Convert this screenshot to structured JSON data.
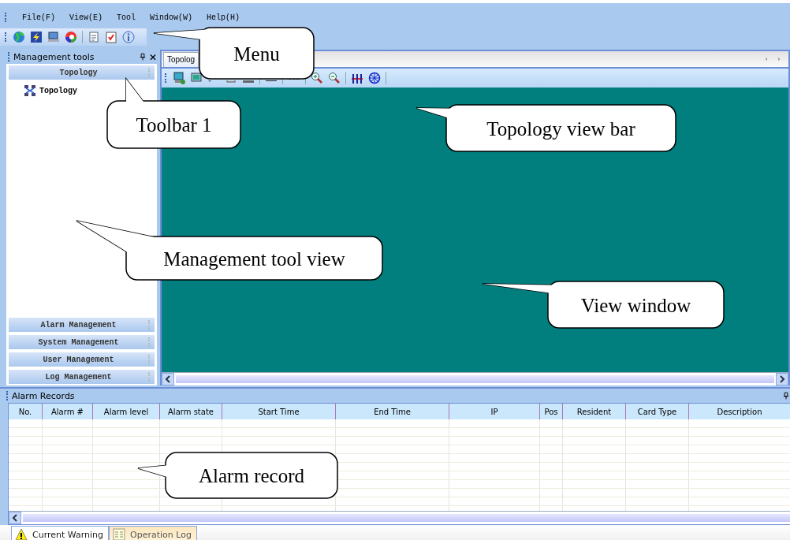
{
  "menu": [
    {
      "label": "File(F)"
    },
    {
      "label": "View(E)"
    },
    {
      "label": "Tool"
    },
    {
      "label": "Window(W)"
    },
    {
      "label": "Help(H)"
    }
  ],
  "management_tools": {
    "title": "Management tools",
    "sections": [
      {
        "label": "Topology",
        "expanded": true,
        "items": [
          {
            "label": "Topology"
          }
        ]
      },
      {
        "label": "Alarm Management",
        "expanded": false
      },
      {
        "label": "System Management",
        "expanded": false
      },
      {
        "label": "User Management",
        "expanded": false
      },
      {
        "label": "Log Management",
        "expanded": false
      }
    ]
  },
  "view_tabs": [
    {
      "label": "Topolog",
      "selected": true
    }
  ],
  "alarm_records": {
    "title": "Alarm Records",
    "columns": [
      "No.",
      "Alarm #",
      "Alarm level",
      "Alarm state",
      "Start Time",
      "End Time",
      "IP",
      "Pos",
      "Resident",
      "Card Type",
      "Description"
    ]
  },
  "bottom_tabs": [
    {
      "label": "Current Warning",
      "selected": true,
      "kind": "warning"
    },
    {
      "label": "Operation Log",
      "selected": false,
      "kind": "log"
    }
  ],
  "callouts": [
    {
      "label": "Menu"
    },
    {
      "label": "Toolbar 1"
    },
    {
      "label": "Topology view bar"
    },
    {
      "label": "Management tool view"
    },
    {
      "label": "View window"
    },
    {
      "label": "Alarm record"
    }
  ]
}
